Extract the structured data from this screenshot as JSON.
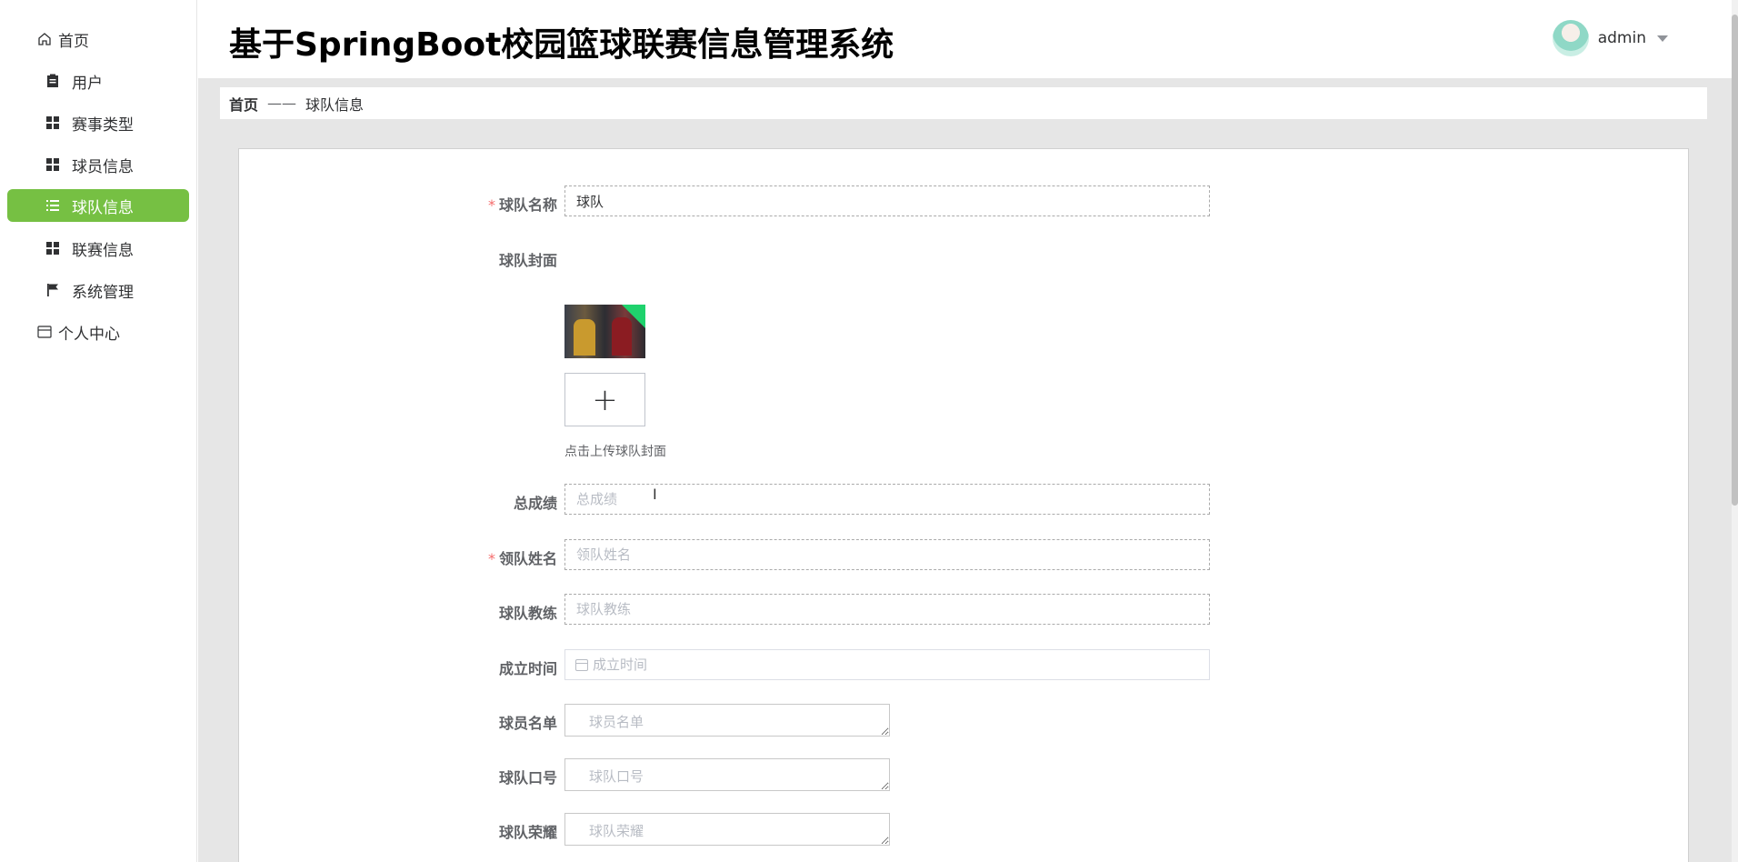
{
  "sidebar": {
    "items": [
      {
        "label": "首页",
        "icon": "home-icon"
      },
      {
        "label": "用户",
        "icon": "clipboard-icon"
      },
      {
        "label": "赛事类型",
        "icon": "grid-icon"
      },
      {
        "label": "球员信息",
        "icon": "grid-icon"
      },
      {
        "label": "球队信息",
        "icon": "list-icon",
        "active": true
      },
      {
        "label": "联赛信息",
        "icon": "grid-icon"
      },
      {
        "label": "系统管理",
        "icon": "flag-icon"
      },
      {
        "label": "个人中心",
        "icon": "wallet-icon"
      }
    ]
  },
  "header": {
    "title": "基于SpringBoot校园篮球联赛信息管理系统",
    "username": "admin"
  },
  "breadcrumb": {
    "home": "首页",
    "separator": "——",
    "current": "球队信息"
  },
  "form": {
    "team_name": {
      "label": "球队名称",
      "value": "球队",
      "required": true
    },
    "team_cover": {
      "label": "球队封面",
      "hint": "点击上传球队封面"
    },
    "total_score": {
      "label": "总成绩",
      "placeholder": "总成绩"
    },
    "leader_name": {
      "label": "领队姓名",
      "placeholder": "领队姓名",
      "required": true
    },
    "coach": {
      "label": "球队教练",
      "placeholder": "球队教练"
    },
    "founded": {
      "label": "成立时间",
      "placeholder": "成立时间"
    },
    "roster": {
      "label": "球员名单",
      "placeholder": "球员名单"
    },
    "slogan": {
      "label": "球队口号",
      "placeholder": "球队口号"
    },
    "honors": {
      "label": "球队荣耀",
      "placeholder": "球队荣耀"
    }
  },
  "colors": {
    "accent": "#76c043",
    "required": "#f56c6c",
    "background": "#e6e6e6"
  }
}
